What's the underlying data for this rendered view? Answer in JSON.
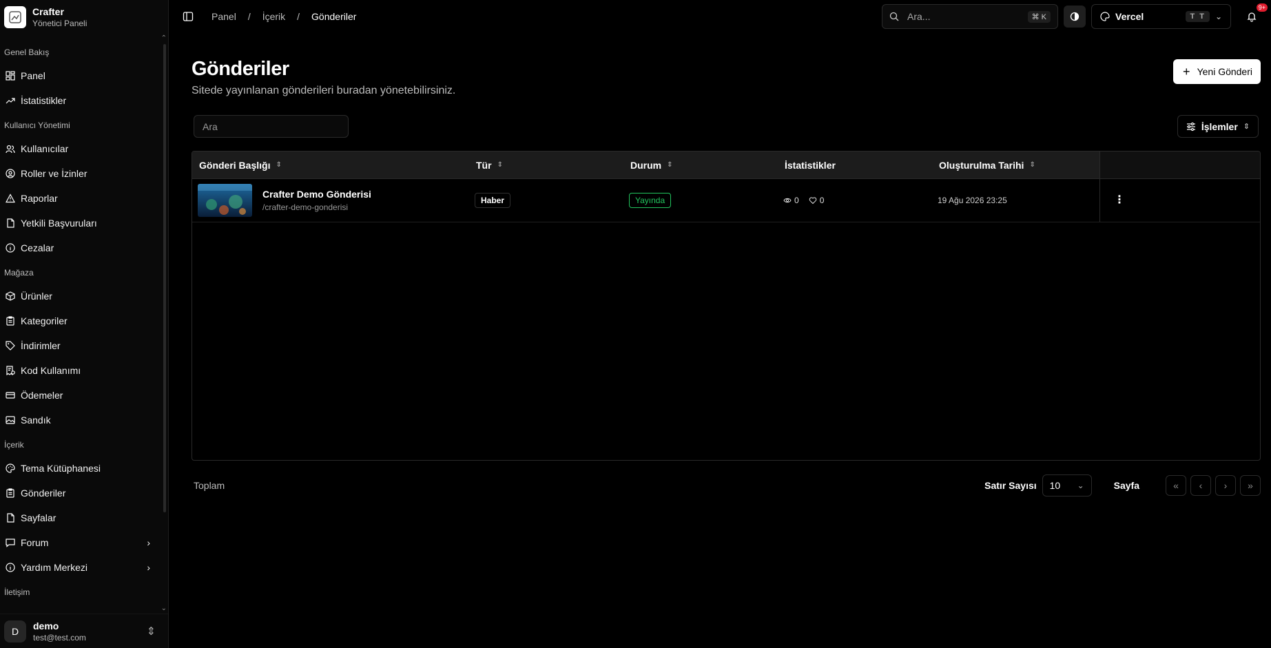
{
  "brand": {
    "name": "Crafter",
    "subtitle": "Yönetici Paneli"
  },
  "sidebar": {
    "groups": [
      {
        "label": "Genel Bakış",
        "items": [
          {
            "label": "Panel",
            "icon": "dashboard-icon"
          },
          {
            "label": "İstatistikler",
            "icon": "trending-up-icon"
          }
        ]
      },
      {
        "label": "Kullanıcı Yönetimi",
        "items": [
          {
            "label": "Kullanıcılar",
            "icon": "users-icon"
          },
          {
            "label": "Roller ve İzinler",
            "icon": "user-circle-icon"
          },
          {
            "label": "Raporlar",
            "icon": "warning-icon"
          },
          {
            "label": "Yetkili Başvuruları",
            "icon": "file-icon"
          },
          {
            "label": "Cezalar",
            "icon": "info-icon"
          }
        ]
      },
      {
        "label": "Mağaza",
        "items": [
          {
            "label": "Ürünler",
            "icon": "box-icon"
          },
          {
            "label": "Kategoriler",
            "icon": "clipboard-icon"
          },
          {
            "label": "İndirimler",
            "icon": "tag-icon"
          },
          {
            "label": "Kod Kullanımı",
            "icon": "receipt-icon"
          },
          {
            "label": "Ödemeler",
            "icon": "credit-card-icon"
          },
          {
            "label": "Sandık",
            "icon": "image-icon"
          }
        ]
      },
      {
        "label": "İçerik",
        "items": [
          {
            "label": "Tema Kütüphanesi",
            "icon": "palette-icon"
          },
          {
            "label": "Gönderiler",
            "icon": "clipboard-icon"
          },
          {
            "label": "Sayfalar",
            "icon": "file-icon"
          },
          {
            "label": "Forum",
            "icon": "message-icon"
          },
          {
            "label": "Yardım Merkezi",
            "icon": "info-icon"
          }
        ]
      },
      {
        "label": "İletişim",
        "items": []
      }
    ]
  },
  "user": {
    "initial": "D",
    "name": "demo",
    "email": "test@test.com"
  },
  "topbar": {
    "breadcrumb": [
      "Panel",
      "İçerik",
      "Gönderiler"
    ],
    "search_placeholder": "Ara...",
    "search_shortcut": "⌘ K",
    "theme_name": "Vercel",
    "theme_badge": "T T",
    "notification_count": "9+"
  },
  "page": {
    "title": "Gönderiler",
    "description": "Sitede yayınlanan gönderileri buradan yönetebilirsiniz.",
    "new_button": "Yeni Gönderi",
    "search_placeholder": "Ara",
    "actions_button": "İşlemler"
  },
  "table": {
    "columns": [
      "Gönderi Başlığı",
      "Tür",
      "Durum",
      "İstatistikler",
      "Oluşturulma Tarihi"
    ],
    "rows": [
      {
        "title": "Crafter Demo Gönderisi",
        "slug": "/crafter-demo-gonderisi",
        "type": "Haber",
        "status": "Yayında",
        "views": "0",
        "likes": "0",
        "date": "19 Ağu 2026 23:25"
      }
    ]
  },
  "pagination": {
    "total_label": "Toplam",
    "rows_label": "Satır Sayısı",
    "rows_value": "10",
    "page_label": "Sayfa"
  },
  "colors": {
    "accent_status": "#22c55e",
    "badge_red": "#e11d2e"
  }
}
